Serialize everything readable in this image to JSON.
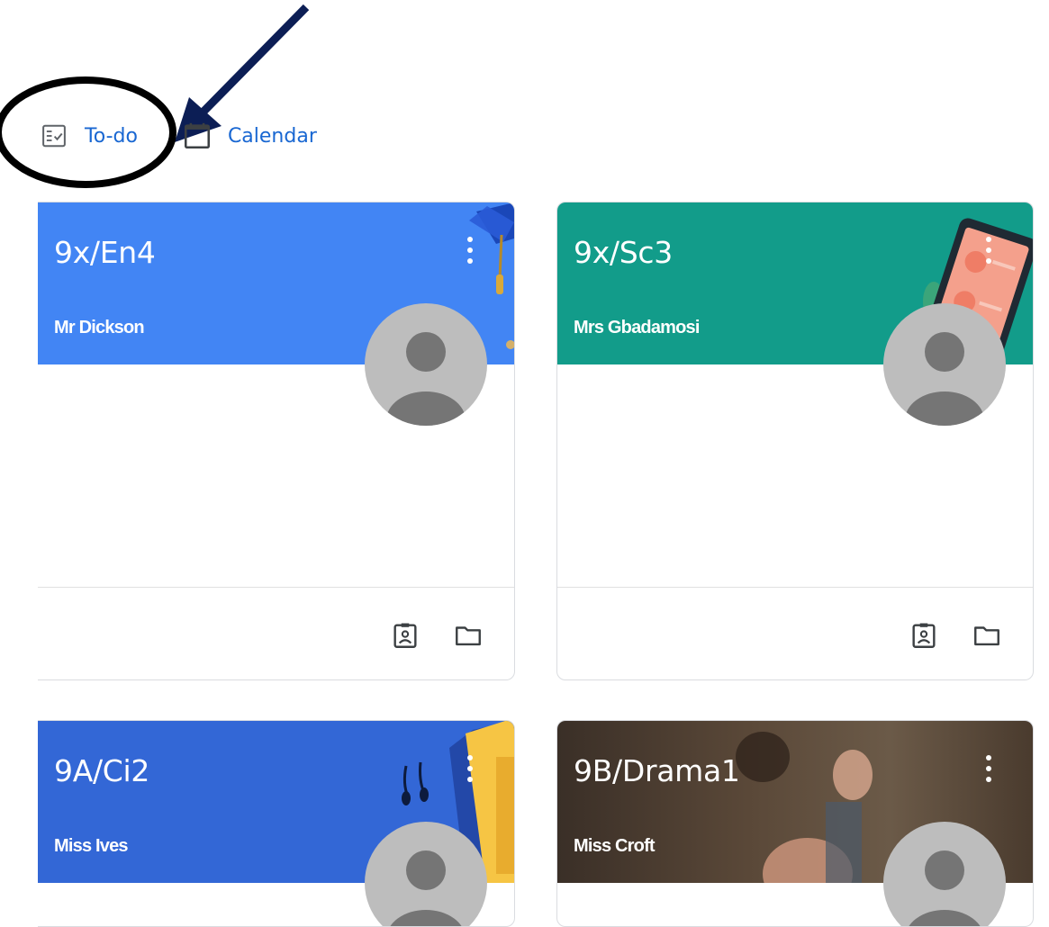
{
  "nav": {
    "todo_label": "To-do",
    "calendar_label": "Calendar",
    "link_color": "#1967d2"
  },
  "annotations": {
    "highlight_shape": "ellipse",
    "highlight_color": "#000000",
    "arrow_color": "#0c1e55"
  },
  "classes": [
    {
      "name": "9x/En4",
      "teacher": "Mr Dickson",
      "banner_color": "#4285f4",
      "theme": "graduation-cap-art",
      "icons": [
        "more-vert-icon",
        "assignment-icon",
        "folder-icon"
      ]
    },
    {
      "name": "9x/Sc3",
      "teacher": "Mrs Gbadamosi",
      "banner_color": "#129c8a",
      "theme": "phone-science-art",
      "icons": [
        "more-vert-icon",
        "assignment-icon",
        "folder-icon"
      ]
    },
    {
      "name": "9A/Ci2",
      "teacher": "Miss Ives",
      "banner_color": "#3367d6",
      "theme": "notebook-earphones-art",
      "icons": [
        "more-vert-icon"
      ]
    },
    {
      "name": "9B/Drama1",
      "teacher": "Miss Croft",
      "banner_color": "#4a3b2e",
      "theme": "theatre-photo-art",
      "icons": [
        "more-vert-icon"
      ]
    }
  ]
}
